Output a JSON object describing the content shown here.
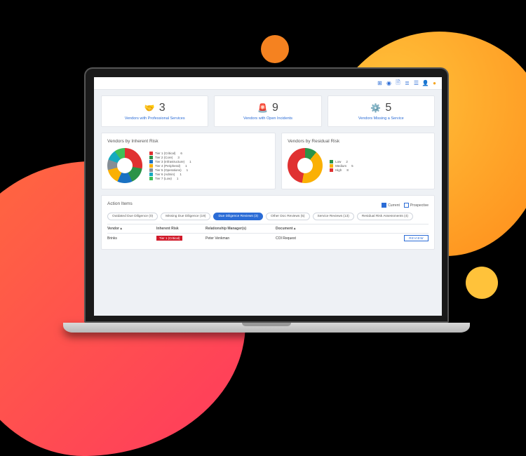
{
  "topbar_icons": [
    "grid",
    "globe",
    "doc",
    "report",
    "list",
    "user",
    "avatar"
  ],
  "kpis": [
    {
      "icon": "🤝",
      "value": "3",
      "label": "Vendors with Professional Services"
    },
    {
      "icon": "🚨",
      "value": "9",
      "label": "Vendors with Open Incidents"
    },
    {
      "icon": "⚙️",
      "value": "5",
      "label": "Vendors Missing a Service"
    }
  ],
  "charts": {
    "inherent": {
      "title": "Vendors by Inherent Risk",
      "legend": [
        {
          "color": "#e03131",
          "label": "Tier 1 (Critical)",
          "value": "6"
        },
        {
          "color": "#2b9348",
          "label": "Tier 2 (Core)",
          "value": "3"
        },
        {
          "color": "#1971c2",
          "label": "Tier 3 (Infrastructure)",
          "value": "1"
        },
        {
          "color": "#fab005",
          "label": "Tier 4 (Peripheral)",
          "value": "1"
        },
        {
          "color": "#868e96",
          "label": "Tier 5 (Operations)",
          "value": "1"
        },
        {
          "color": "#15aabf",
          "label": "Tier 6 (Admin)",
          "value": "1"
        },
        {
          "color": "#40c057",
          "label": "Tier 7 (Low)",
          "value": "1"
        }
      ]
    },
    "residual": {
      "title": "Vendors by Residual Risk",
      "legend": [
        {
          "color": "#2b9348",
          "label": "Low",
          "value": "2"
        },
        {
          "color": "#fab005",
          "label": "Medium",
          "value": "5"
        },
        {
          "color": "#e03131",
          "label": "High",
          "value": "8"
        }
      ]
    }
  },
  "actions": {
    "title": "Action Items",
    "filters": {
      "current": "Current",
      "prospective": "Prospective"
    },
    "tabs": [
      {
        "label": "Outdated Due Diligence (0)",
        "active": false
      },
      {
        "label": "Missing Due Diligence (19)",
        "active": false
      },
      {
        "label": "Due Diligence Reviews (3)",
        "active": true
      },
      {
        "label": "Other Doc Reviews (5)",
        "active": false
      },
      {
        "label": "Service Reviews (13)",
        "active": false
      },
      {
        "label": "Residual Risk Assessments (4)",
        "active": false
      }
    ],
    "columns": [
      "Vendor ▴",
      "Inherent Risk",
      "Relationship Manager(s)",
      "Document ▴",
      ""
    ],
    "rows": [
      {
        "vendor": "Brinks",
        "risk": "Tier 1 (Critical)",
        "manager": "Peter Venkman",
        "document": "COI Request",
        "action": "REVIEW"
      }
    ]
  },
  "chart_data": [
    {
      "type": "pie",
      "title": "Vendors by Inherent Risk",
      "categories": [
        "Tier 1 (Critical)",
        "Tier 2 (Core)",
        "Tier 3 (Infrastructure)",
        "Tier 4 (Peripheral)",
        "Tier 5 (Operations)",
        "Tier 6 (Admin)",
        "Tier 7 (Low)"
      ],
      "values": [
        6,
        3,
        1,
        1,
        1,
        1,
        1
      ]
    },
    {
      "type": "pie",
      "title": "Vendors by Residual Risk",
      "categories": [
        "Low",
        "Medium",
        "High"
      ],
      "values": [
        2,
        5,
        8
      ]
    }
  ]
}
